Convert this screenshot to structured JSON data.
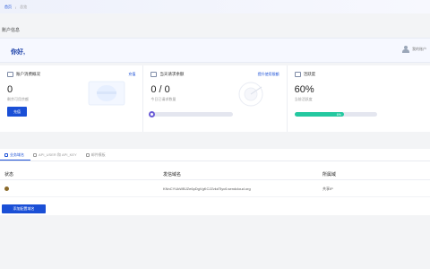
{
  "breadcrumb": {
    "home": "首页",
    "separator": "/",
    "current": "总览"
  },
  "section_title": "账户信息",
  "greeting": "你好,",
  "user_link": "我的账户",
  "stats": [
    {
      "icon": "wallet-icon",
      "label": "账户消费概况",
      "link": "充值",
      "value": "0",
      "sub": "剩余可用余额",
      "button": "充值"
    },
    {
      "icon": "request-icon",
      "label": "当天请求余额",
      "link": "提升使用限额",
      "value": "0 / 0",
      "sub": "今日已请求数量"
    },
    {
      "icon": "diamond-icon",
      "label": "活跃度",
      "value": "60%",
      "sub": "当前活跃度",
      "progress": 0.6,
      "progress_label": "6%"
    }
  ],
  "tabs": [
    {
      "label": "业务域名",
      "active": true
    },
    {
      "label": "API_USER 和 API_KEY",
      "active": false
    },
    {
      "label": "邮件模板",
      "active": false
    }
  ],
  "table": {
    "headers": [
      "状态",
      "发信域名",
      "所属域"
    ],
    "rows": [
      {
        "status_color": "#8b6a2a",
        "domain": "KNnCYUkWBJZe6pDgVgKCJZvkdTiyc6.sendcloud.org",
        "owner": "共享IP"
      }
    ]
  },
  "add_button": "添加配置域名",
  "colors": {
    "accent": "#1a4fd6",
    "progress": "#24c8a0"
  }
}
